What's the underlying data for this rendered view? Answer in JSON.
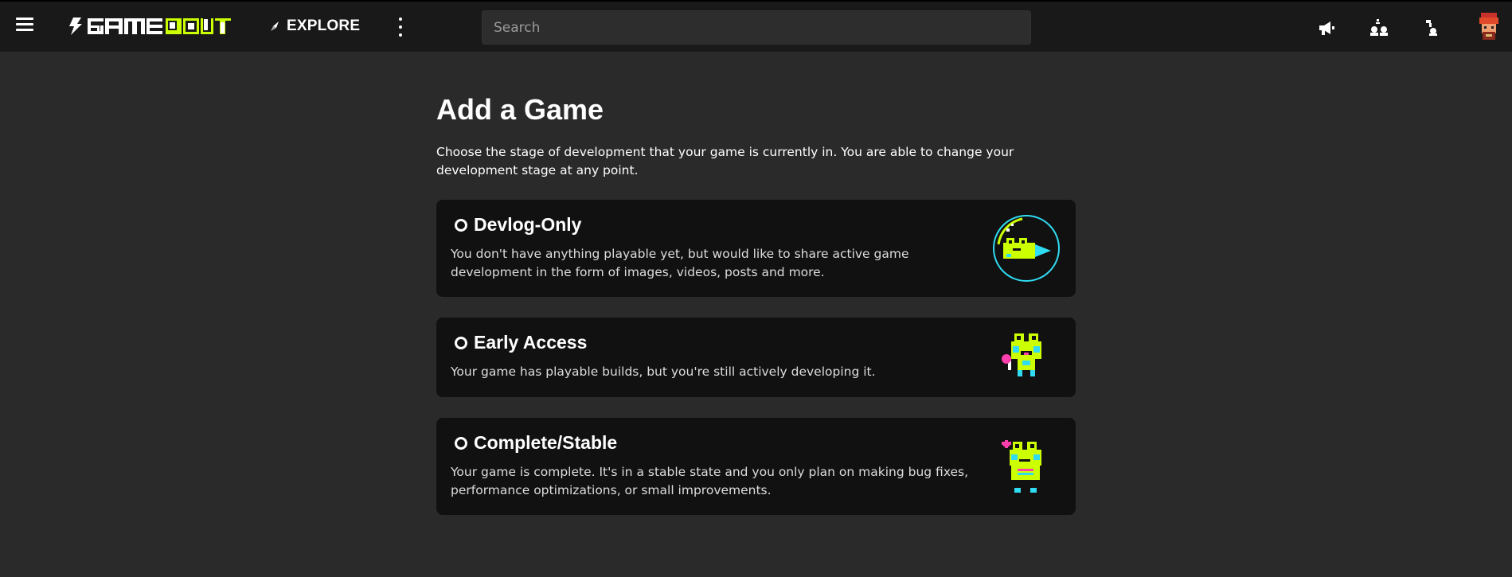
{
  "header": {
    "menu_icon": "hamburger-icon",
    "logo_text": "GAME JOLT",
    "explore_label": "EXPLORE",
    "explore_icon": "compass-icon",
    "more_icon": "vertical-dots-icon",
    "search_placeholder": "Search",
    "icons": [
      "megaphone-icon",
      "user-group-icon",
      "notification-icon",
      "avatar"
    ]
  },
  "page": {
    "title": "Add a Game",
    "intro": "Choose the stage of development that your game is currently in. You are able to change your development stage at any point."
  },
  "stages": [
    {
      "title": "Devlog-Only",
      "description": "You don't have anything playable yet, but would like to share active game development in the form of images, videos, posts and more.",
      "art": "frog-bubble-illustration"
    },
    {
      "title": "Early Access",
      "description": "Your game has playable builds, but you're still actively developing it.",
      "art": "frog-lollipop-illustration"
    },
    {
      "title": "Complete/Stable",
      "description": "Your game is complete. It's in a stable state and you only plan on making bug fixes, performance optimizations, or small improvements.",
      "art": "frog-heart-illustration"
    }
  ],
  "colors": {
    "background": "#2a2a2a",
    "topbar": "#191919",
    "card": "#111111",
    "accent_green": "#ccff00",
    "accent_cyan": "#2fdcf2",
    "accent_pink": "#ff3fac"
  }
}
